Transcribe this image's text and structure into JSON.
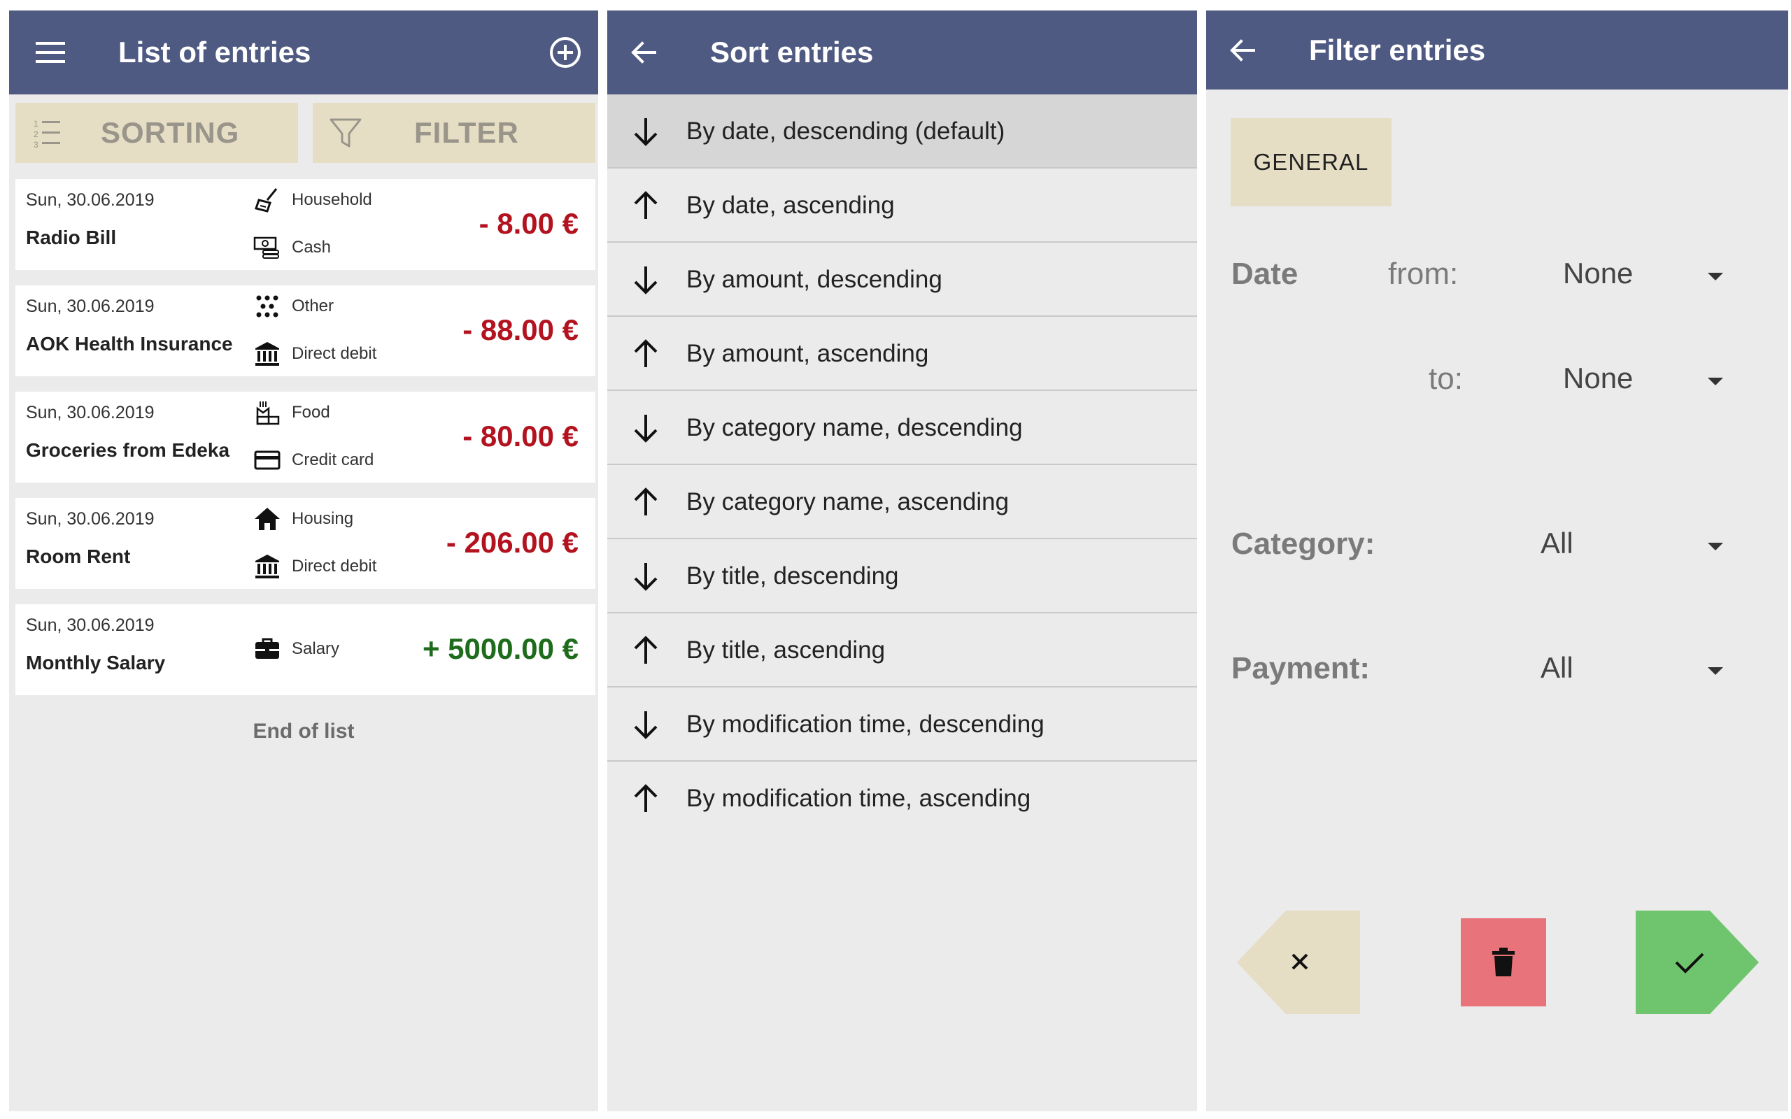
{
  "colors": {
    "appbar": "#4f5a82",
    "panel_bg": "#ebebeb",
    "beige": "#e6dec4",
    "negative": "#b3121f",
    "positive": "#1e6b1b",
    "delete_btn": "#e8737a",
    "ok_btn": "#6fc46e"
  },
  "list_screen": {
    "title": "List of entries",
    "menu_icon": "hamburger-menu-icon",
    "add_icon": "add-circle-icon",
    "sorting_label": "SORTING",
    "filter_label": "FILTER",
    "entries": [
      {
        "date": "Sun, 30.06.2019",
        "title": "Radio Bill",
        "category": "Household",
        "category_icon": "broom-icon",
        "payment": "Cash",
        "payment_icon": "cash-icon",
        "amount": "- 8.00 €",
        "sign": "negative"
      },
      {
        "date": "Sun, 30.06.2019",
        "title": "AOK Health Insurance",
        "category": "Other",
        "category_icon": "dots-icon",
        "payment": "Direct debit",
        "payment_icon": "bank-icon",
        "amount": "- 88.00 €",
        "sign": "negative"
      },
      {
        "date": "Sun, 30.06.2019",
        "title": "Groceries from Edeka",
        "category": "Food",
        "category_icon": "food-icon",
        "payment": "Credit card",
        "payment_icon": "credit-card-icon",
        "amount": "- 80.00 €",
        "sign": "negative"
      },
      {
        "date": "Sun, 30.06.2019",
        "title": "Room Rent",
        "category": "Housing",
        "category_icon": "home-icon",
        "payment": "Direct debit",
        "payment_icon": "bank-icon",
        "amount": "- 206.00 €",
        "sign": "negative"
      },
      {
        "date": "Sun, 30.06.2019",
        "title": "Monthly Salary",
        "category": "Salary",
        "category_icon": "briefcase-icon",
        "payment": "",
        "payment_icon": "",
        "amount": "+ 5000.00 €",
        "sign": "positive"
      }
    ],
    "end_text": "End of list"
  },
  "sort_screen": {
    "title": "Sort entries",
    "back_icon": "arrow-back-icon",
    "options": [
      {
        "label": "By date, descending (default)",
        "direction": "down",
        "selected": true
      },
      {
        "label": "By date, ascending",
        "direction": "up",
        "selected": false
      },
      {
        "label": "By amount, descending",
        "direction": "down",
        "selected": false
      },
      {
        "label": "By amount, ascending",
        "direction": "up",
        "selected": false
      },
      {
        "label": "By category name, descending",
        "direction": "down",
        "selected": false
      },
      {
        "label": "By category name, ascending",
        "direction": "up",
        "selected": false
      },
      {
        "label": "By title, descending",
        "direction": "down",
        "selected": false
      },
      {
        "label": "By title, ascending",
        "direction": "up",
        "selected": false
      },
      {
        "label": "By modification time, descending",
        "direction": "down",
        "selected": false
      },
      {
        "label": "By modification time, ascending",
        "direction": "up",
        "selected": false
      }
    ]
  },
  "filter_screen": {
    "title": "Filter entries",
    "back_icon": "arrow-back-icon",
    "tab": "GENERAL",
    "date_label": "Date",
    "from_label": "from:",
    "from_value": "None",
    "to_label": "to:",
    "to_value": "None",
    "category_label": "Category:",
    "category_value": "All",
    "payment_label": "Payment:",
    "payment_value": "All",
    "cancel_icon": "close-icon",
    "delete_icon": "trash-icon",
    "confirm_icon": "check-icon"
  }
}
